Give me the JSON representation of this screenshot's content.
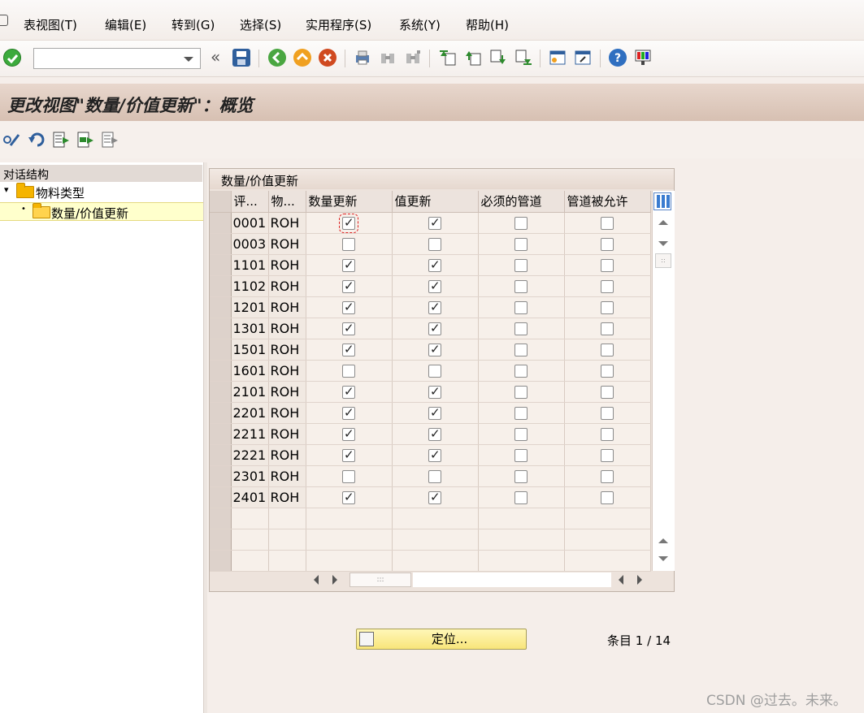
{
  "menu": [
    {
      "label": "表视图(T)"
    },
    {
      "label": "编辑(E)"
    },
    {
      "label": "转到(G)"
    },
    {
      "label": "选择(S)"
    },
    {
      "label": "实用程序(S)"
    },
    {
      "label": "系统(Y)"
    },
    {
      "label": "帮助(H)"
    }
  ],
  "toolbar": {
    "command_value": "",
    "icons": [
      "enter-icon",
      "save-icon",
      "back-icon",
      "exit-icon",
      "cancel-icon",
      "print-icon",
      "find-icon",
      "find-next-icon",
      "first-page-icon",
      "prev-page-icon",
      "next-page-icon",
      "last-page-icon",
      "new-session-icon",
      "shortcut-icon",
      "help-icon",
      "layout-icon"
    ]
  },
  "screen_title": "更改视图\"数量/价值更新\"：概览",
  "app_toolbar": {
    "icons": [
      "display-change-icon",
      "undo-icon",
      "select-all-icon",
      "select-block-icon",
      "deselect-all-icon"
    ]
  },
  "tree": {
    "header": "对话结构",
    "items": [
      {
        "label": "物料类型"
      },
      {
        "label": "数量/价值更新"
      }
    ]
  },
  "table": {
    "title": "数量/价值更新",
    "columns": [
      "评...",
      "物...",
      "数量更新",
      "值更新",
      "必须的管道",
      "管道被允许"
    ],
    "rows": [
      {
        "valuation_area": "0001",
        "material_type": "ROH",
        "qty_update": true,
        "value_update": true,
        "pipeline_mandatory": false,
        "pipeline_allowed": false
      },
      {
        "valuation_area": "0003",
        "material_type": "ROH",
        "qty_update": false,
        "value_update": false,
        "pipeline_mandatory": false,
        "pipeline_allowed": false
      },
      {
        "valuation_area": "1101",
        "material_type": "ROH",
        "qty_update": true,
        "value_update": true,
        "pipeline_mandatory": false,
        "pipeline_allowed": false
      },
      {
        "valuation_area": "1102",
        "material_type": "ROH",
        "qty_update": true,
        "value_update": true,
        "pipeline_mandatory": false,
        "pipeline_allowed": false
      },
      {
        "valuation_area": "1201",
        "material_type": "ROH",
        "qty_update": true,
        "value_update": true,
        "pipeline_mandatory": false,
        "pipeline_allowed": false
      },
      {
        "valuation_area": "1301",
        "material_type": "ROH",
        "qty_update": true,
        "value_update": true,
        "pipeline_mandatory": false,
        "pipeline_allowed": false
      },
      {
        "valuation_area": "1501",
        "material_type": "ROH",
        "qty_update": true,
        "value_update": true,
        "pipeline_mandatory": false,
        "pipeline_allowed": false
      },
      {
        "valuation_area": "1601",
        "material_type": "ROH",
        "qty_update": false,
        "value_update": false,
        "pipeline_mandatory": false,
        "pipeline_allowed": false
      },
      {
        "valuation_area": "2101",
        "material_type": "ROH",
        "qty_update": true,
        "value_update": true,
        "pipeline_mandatory": false,
        "pipeline_allowed": false
      },
      {
        "valuation_area": "2201",
        "material_type": "ROH",
        "qty_update": true,
        "value_update": true,
        "pipeline_mandatory": false,
        "pipeline_allowed": false
      },
      {
        "valuation_area": "2211",
        "material_type": "ROH",
        "qty_update": true,
        "value_update": true,
        "pipeline_mandatory": false,
        "pipeline_allowed": false
      },
      {
        "valuation_area": "2221",
        "material_type": "ROH",
        "qty_update": true,
        "value_update": true,
        "pipeline_mandatory": false,
        "pipeline_allowed": false
      },
      {
        "valuation_area": "2301",
        "material_type": "ROH",
        "qty_update": false,
        "value_update": false,
        "pipeline_mandatory": false,
        "pipeline_allowed": false
      },
      {
        "valuation_area": "2401",
        "material_type": "ROH",
        "qty_update": true,
        "value_update": true,
        "pipeline_mandatory": false,
        "pipeline_allowed": false
      }
    ],
    "empty_rows": 3
  },
  "position_button": {
    "label": "定位..."
  },
  "entries": {
    "label": "条目",
    "current": "1",
    "total": "14"
  },
  "watermark": "CSDN @过去。未来。",
  "colors": {
    "title_bar": "#dcc6b8",
    "selected_tree": "#ffffcc",
    "position_button": "#f8e57a",
    "check_focus": "#dd2222"
  }
}
